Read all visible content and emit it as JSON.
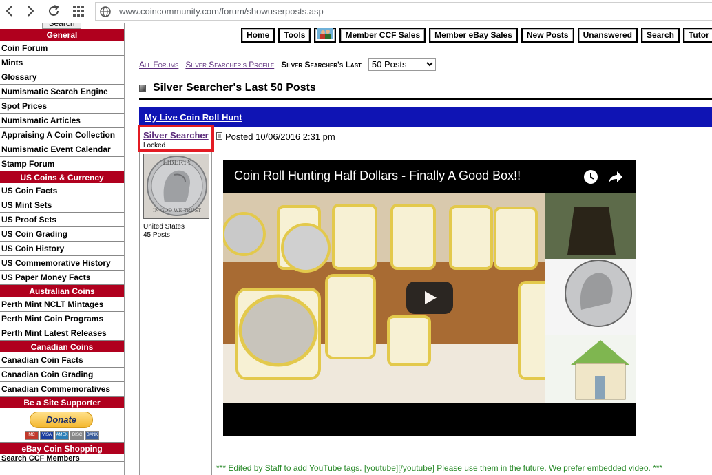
{
  "browser": {
    "url": "www.coincommunity.com/forum/showuserposts.asp"
  },
  "sidebar": {
    "search_label": "Search",
    "sections": [
      {
        "heading": "General",
        "items": [
          "Coin Forum",
          "Mints",
          "Glossary",
          "Numismatic Search Engine",
          "Spot Prices",
          "Numismatic Articles",
          "Appraising A Coin Collection",
          "Numismatic Event Calendar",
          "Stamp Forum"
        ]
      },
      {
        "heading": "US Coins & Currency",
        "items": [
          "US Coin Facts",
          "US Mint Sets",
          "US Proof Sets",
          "US Coin Grading",
          "US Coin History",
          "US Commemorative History",
          "US Paper Money Facts"
        ]
      },
      {
        "heading": "Australian Coins",
        "items": [
          "Perth Mint NCLT Mintages",
          "Perth Mint Coin Programs",
          "Perth Mint Latest Releases"
        ]
      },
      {
        "heading": "Canadian Coins",
        "items": [
          "Canadian Coin Facts",
          "Canadian Coin Grading",
          "Canadian Commemoratives"
        ]
      }
    ],
    "supporter_heading": "Be a Site Supporter",
    "donate_label": "Donate",
    "card_labels": [
      "MC",
      "VISA",
      "AMEX",
      "DISC",
      "BANK"
    ],
    "ebay_heading": "eBay Coin Shopping",
    "ebay_partial": "Search CCF Members"
  },
  "topnav": {
    "buttons": [
      "Home",
      "Tools",
      "",
      "Member CCF Sales",
      "Member eBay Sales",
      "New Posts",
      "Unanswered",
      "Search",
      "Tutor"
    ]
  },
  "breadcrumb": {
    "all_forums": "All Forums",
    "profile": "Silver Searcher's Profile",
    "last_label": "Silver Searcher's Last",
    "select_value": "50 Posts"
  },
  "page_title": "Silver Searcher's Last 50 Posts",
  "topic_title": "My Live Coin Roll Hunt",
  "post": {
    "author": "Silver Searcher",
    "status": "Locked",
    "location": "United States",
    "post_count": "45 Posts",
    "posted": "Posted 10/06/2016  2:31 pm",
    "video_title": "Coin Roll Hunting Half Dollars - Finally A Good Box!!",
    "edit_note": "*** Edited by Staff to add YouTube tags. [youtube][/youtube] Please use them in the future. We prefer embedded video. ***"
  },
  "colors": {
    "sidebar_heading": "#b0001e",
    "topic_bar": "#0f14b4",
    "highlight": "#e31b23",
    "link": "#5a2a7a",
    "edit_note": "#2a8a2a"
  }
}
